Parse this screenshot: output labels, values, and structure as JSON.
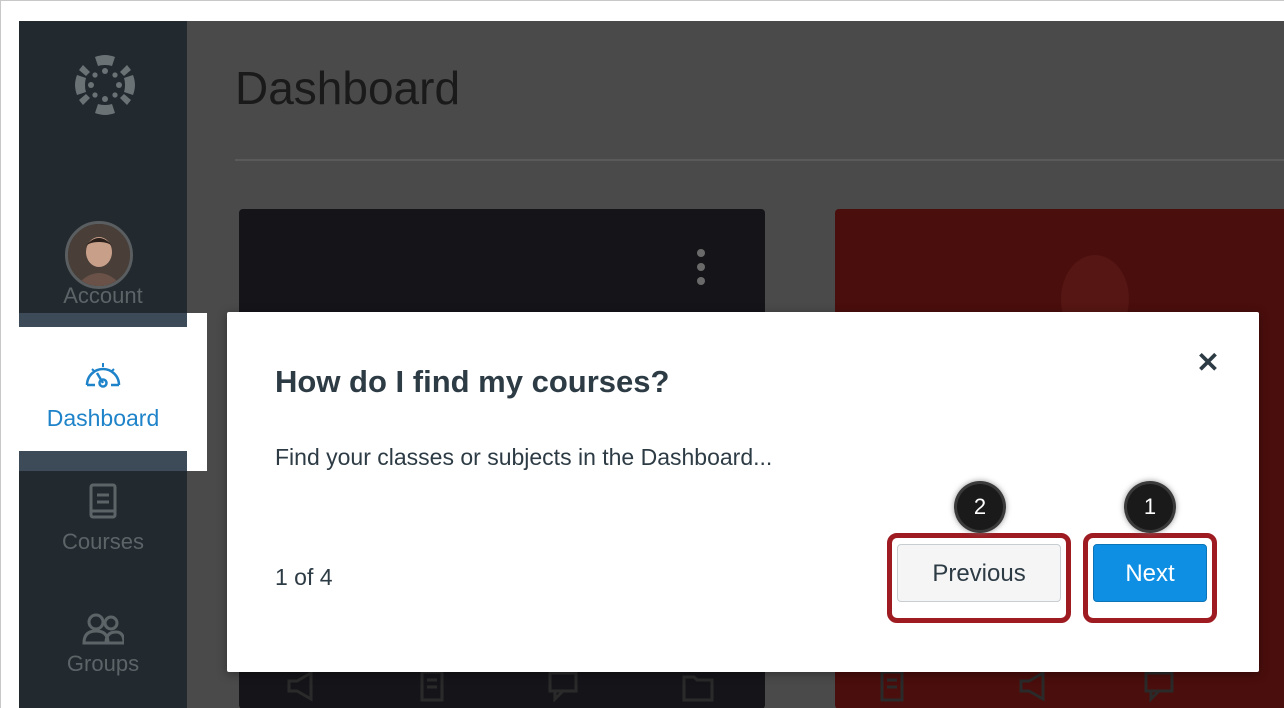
{
  "page": {
    "title": "Dashboard"
  },
  "nav": {
    "items": [
      {
        "label": "Account",
        "icon": "avatar"
      },
      {
        "label": "Dashboard",
        "icon": "dashboard-icon",
        "active": true
      },
      {
        "label": "Courses",
        "icon": "book-icon"
      },
      {
        "label": "Groups",
        "icon": "groups-icon"
      }
    ],
    "logo": "canvas-logo-icon"
  },
  "modal": {
    "title": "How do I find my courses?",
    "body": "Find your classes or subjects in the Dashboard...",
    "counter": "1 of 4",
    "close_glyph": "✕",
    "previous_label": "Previous",
    "next_label": "Next"
  },
  "callouts": {
    "next": "1",
    "previous": "2"
  },
  "colors": {
    "nav_bg": "#222a30",
    "active_link": "#1e83c9",
    "next_button": "#0e8fe4",
    "highlight": "#9e1b22"
  }
}
